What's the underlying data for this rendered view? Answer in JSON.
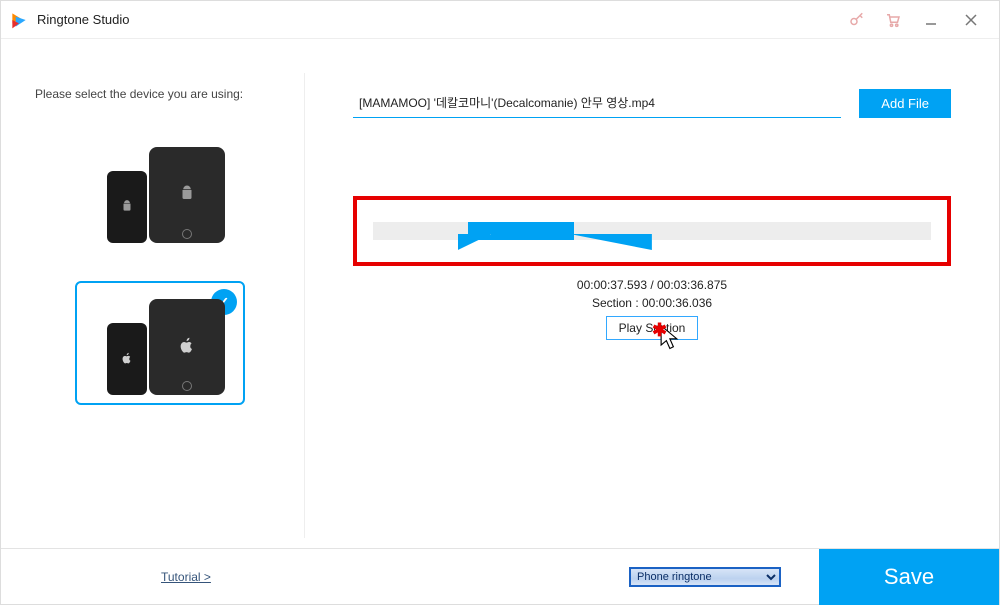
{
  "window": {
    "title": "Ringtone Studio"
  },
  "left": {
    "prompt": "Please select the device you are using:",
    "devices": [
      {
        "id": "android",
        "label": "Android",
        "icon": "android",
        "selected": false
      },
      {
        "id": "apple",
        "label": "Apple",
        "icon": "apple",
        "selected": true
      }
    ]
  },
  "file": {
    "name": "[MAMAMOO] '데칼코마니'(Decalcomanie) 안무 영상.mp4",
    "add_label": "Add File"
  },
  "editor": {
    "section_start_pct": 17,
    "section_end_pct": 36,
    "time_line": "00:00:37.593 / 00:03:36.875",
    "section_line": "Section : 00:00:36.036",
    "play_section_label": "Play Section"
  },
  "bottom": {
    "tutorial_label": "Tutorial >",
    "select_value": "Phone ringtone",
    "select_options": [
      "Phone ringtone"
    ],
    "save_label": "Save"
  },
  "colors": {
    "accent": "#00a2f3",
    "highlight_border": "#e60000"
  }
}
